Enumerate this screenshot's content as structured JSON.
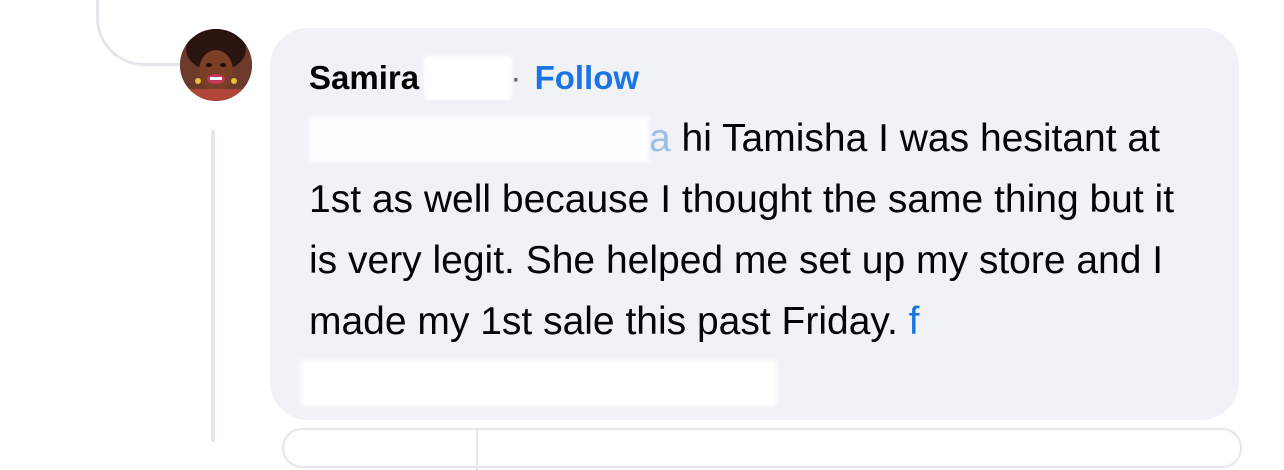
{
  "comment": {
    "author": "Samira F",
    "separator": "·",
    "follow_label": "Follow",
    "mention_visible_fragment": "a",
    "text_line1": "hi Tamisha I was hesitant",
    "text_rest": "at 1st as well because I thought the same thing but it is very legit.  She helped me set up my store and I made my 1st sale this past Friday.",
    "link_visible_fragment": "f"
  },
  "colors": {
    "bubble_bg": "#f0f2f5",
    "link_blue": "#1b74e4",
    "thread_line": "#e4e6eb"
  },
  "icons": {
    "avatar": "user-avatar-photo"
  }
}
